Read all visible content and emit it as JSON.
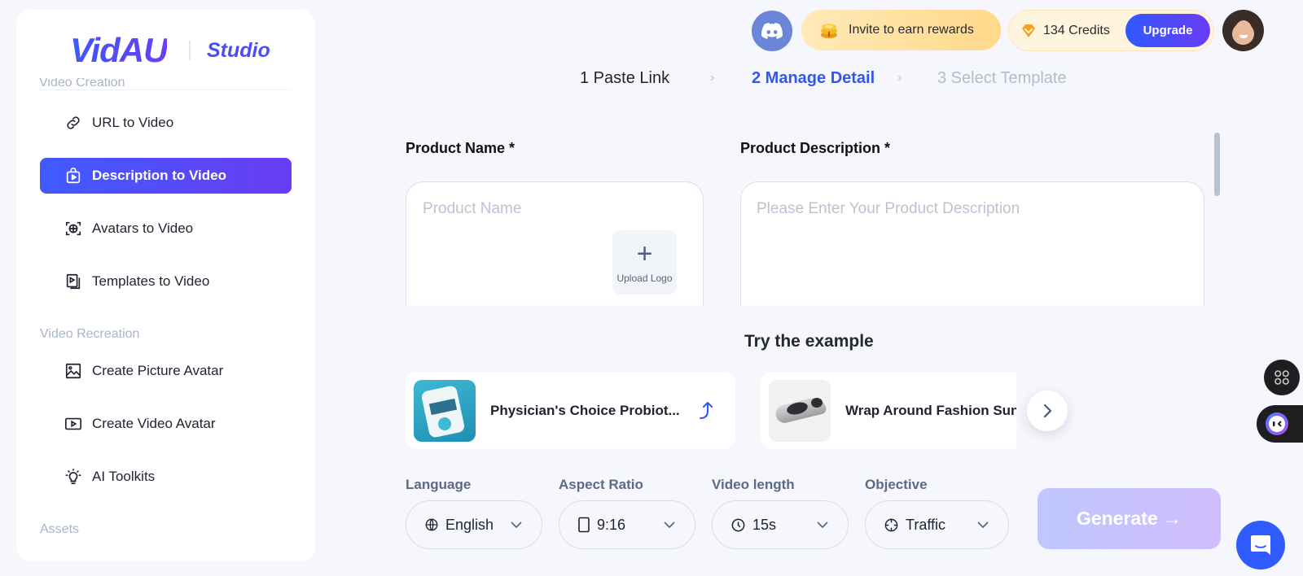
{
  "brand": {
    "logo": "VidAU",
    "product": "Studio"
  },
  "sidebar": {
    "cut_section": "Video Creation",
    "items": [
      {
        "label": "URL to Video",
        "icon": "link-icon",
        "active": false
      },
      {
        "label": "Description to Video",
        "icon": "bag-play-icon",
        "active": true
      },
      {
        "label": "Avatars to Video",
        "icon": "avatar-scan-icon",
        "active": false
      },
      {
        "label": "Templates to Video",
        "icon": "template-icon",
        "active": false
      }
    ],
    "section_recreation": "Video Recreation",
    "recreation_items": [
      {
        "label": "Create Picture Avatar",
        "icon": "image-icon"
      },
      {
        "label": "Create Video Avatar",
        "icon": "video-play-icon"
      },
      {
        "label": "AI Toolkits",
        "icon": "lightbulb-icon"
      }
    ],
    "section_assets": "Assets"
  },
  "topbar": {
    "invite_label": "Invite to earn rewards",
    "credits_label": "134 Credits",
    "upgrade_label": "Upgrade"
  },
  "steps": [
    {
      "label": "1 Paste Link",
      "state": "done"
    },
    {
      "label": "2 Manage Detail",
      "state": "active"
    },
    {
      "label": "3 Select Template",
      "state": "pending"
    }
  ],
  "form": {
    "product_name_label": "Product Name *",
    "product_name_placeholder": "Product Name",
    "product_name_value": "",
    "upload_logo_label": "Upload Logo",
    "product_desc_label": "Product Description *",
    "product_desc_placeholder": "Please Enter Your Product Description",
    "product_desc_value": ""
  },
  "examples": {
    "title": "Try the example",
    "items": [
      {
        "name": "Physician's Choice Probiot...",
        "thumb": "probiotic-bottle"
      },
      {
        "name": "Wrap Around Fashion Sunglasses",
        "thumb": "sunglasses"
      }
    ]
  },
  "options": {
    "language": {
      "label": "Language",
      "value": "English"
    },
    "aspect": {
      "label": "Aspect Ratio",
      "value": "9:16"
    },
    "length": {
      "label": "Video length",
      "value": "15s"
    },
    "objective": {
      "label": "Objective",
      "value": "Traffic"
    }
  },
  "generate_label": "Generate →",
  "colors": {
    "accent": "#3356f0",
    "accent_gradient_end": "#6a3cf5",
    "muted": "#b2bccb"
  }
}
